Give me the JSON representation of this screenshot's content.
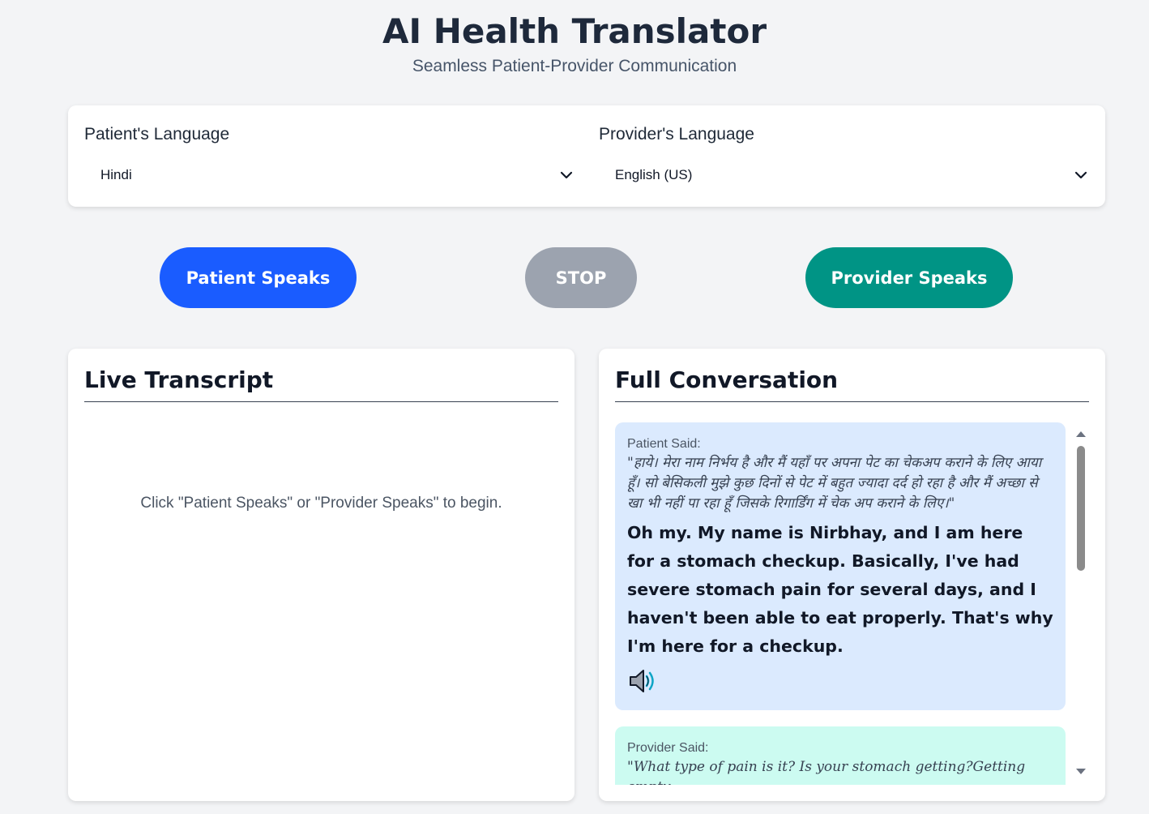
{
  "header": {
    "title": "AI Health Translator",
    "subtitle": "Seamless Patient-Provider Communication"
  },
  "languages": {
    "patient_label": "Patient's Language",
    "patient_value": "Hindi",
    "provider_label": "Provider's Language",
    "provider_value": "English (US)"
  },
  "controls": {
    "patient_button": "Patient Speaks",
    "stop_button": "STOP",
    "provider_button": "Provider Speaks",
    "patient_color": "#1a5cff",
    "stop_color": "#9ca3af",
    "provider_color": "#009485"
  },
  "live_transcript": {
    "title": "Live Transcript",
    "placeholder": "Click \"Patient Speaks\" or \"Provider Speaks\" to begin."
  },
  "conversation": {
    "title": "Full Conversation",
    "messages": [
      {
        "label": "Patient Said:",
        "original": "\"हाये। मेरा नाम निर्भय है और मैं यहाँ पर अपना पेट का चेकअप कराने के लिए आया हूँ। सो बेसिकली मुझे कुछ दिनों से पेट में बहुत ज्यादा दर्द हो रहा है और मैं अच्छा से खा भी नहीं पा रहा हूँ जिसके रिगार्डिंग में चेक अप कराने के लिए।\"",
        "translation": "Oh my. My name is Nirbhay, and I am here for a stomach checkup. Basically, I've had severe stomach pain for several days, and I haven't been able to eat properly. That's why I'm here for a checkup.",
        "icon": "speaker-icon",
        "color": "#dbeafe"
      },
      {
        "label": "Provider Said:",
        "original": "\"What type of pain is it? Is your stomach getting?Getting empty",
        "color": "#ccfbf1"
      }
    ]
  }
}
